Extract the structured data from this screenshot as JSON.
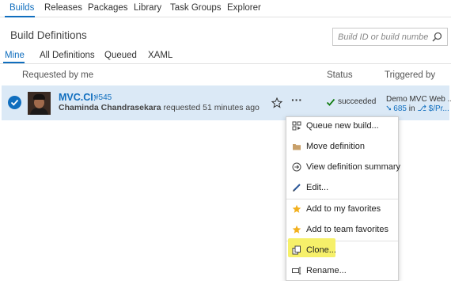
{
  "top_nav": {
    "tabs": [
      "Builds",
      "Releases",
      "Packages",
      "Library",
      "Task Groups",
      "Explorer"
    ],
    "active_tab": "Builds"
  },
  "page": {
    "title": "Build Definitions",
    "search_placeholder": "Build ID or build number"
  },
  "sub_tabs": {
    "tabs": [
      "Mine",
      "All Definitions",
      "Queued",
      "XAML"
    ],
    "active_tab": "Mine"
  },
  "columns": {
    "requested_by": "Requested by me",
    "status": "Status",
    "triggered_by": "Triggered by"
  },
  "build": {
    "name": "MVC.CI",
    "separator": ":",
    "number": "#545",
    "requester": "Chaminda Chandrasekara",
    "requested_text": "requested 51 minutes ago",
    "status": "succeeded",
    "trigger_title": "Demo MVC Web ...",
    "trigger_changeset": "685",
    "trigger_in": "in",
    "trigger_path": "$/Pr...",
    "more_label": "···"
  },
  "context_menu": {
    "items": [
      {
        "label": "Queue new build...",
        "icon": "queue-build-icon"
      },
      {
        "label": "Move definition",
        "icon": "folder-icon"
      },
      {
        "label": "View definition summary",
        "icon": "summary-arrow-icon"
      },
      {
        "label": "Edit...",
        "icon": "pencil-icon"
      },
      {
        "label": "Add to my favorites",
        "icon": "star-icon"
      },
      {
        "label": "Add to team favorites",
        "icon": "star-icon"
      },
      {
        "label": "Clone...",
        "icon": "clone-icon"
      },
      {
        "label": "Rename...",
        "icon": "rename-icon"
      }
    ],
    "highlighted_item": "Clone..."
  },
  "colors": {
    "accent": "#106ebe",
    "selected_row": "#dbe9f6",
    "success": "#107c10",
    "favorite_star": "#f2b01e",
    "highlight": "#f6f06a"
  }
}
